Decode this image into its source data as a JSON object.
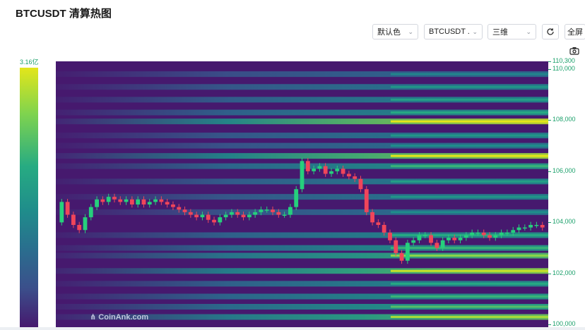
{
  "title": "BTCUSDT 清算热图",
  "controls": {
    "color_select": "默认色",
    "symbol_select": "BTCUSDT ...",
    "view_select": "三维",
    "refresh_icon": "refresh-icon",
    "fullscreen_label": "全屏",
    "camera_icon": "camera-icon"
  },
  "legend": {
    "max_label": "3.16亿"
  },
  "watermark": "CoinAnk.com",
  "chart_data": {
    "type": "heatmap",
    "title": "",
    "xlabel": "",
    "ylabel": "",
    "ylim": [
      99900,
      110300
    ],
    "y_ticks": [
      110300,
      110000,
      108000,
      106000,
      104000,
      102000,
      100000
    ],
    "y_tick_labels": [
      "110,300",
      "110,000",
      "108,000",
      "106,000",
      "104,000",
      "102,000",
      "100,000"
    ],
    "colorscale": {
      "max": "3.16亿",
      "colors": [
        "#46196e",
        "#3b4f8b",
        "#2a6e8e",
        "#1f8d8b",
        "#27ab82",
        "#7ed34f",
        "#e3e61a"
      ]
    },
    "liquidation_levels": [
      {
        "price": 109800,
        "intensity": 0.35
      },
      {
        "price": 109300,
        "intensity": 0.45
      },
      {
        "price": 108800,
        "intensity": 0.5
      },
      {
        "price": 108300,
        "intensity": 0.55
      },
      {
        "price": 107950,
        "intensity": 0.95
      },
      {
        "price": 107400,
        "intensity": 0.45
      },
      {
        "price": 107000,
        "intensity": 0.4
      },
      {
        "price": 106600,
        "intensity": 0.9
      },
      {
        "price": 106200,
        "intensity": 0.6
      },
      {
        "price": 105600,
        "intensity": 0.5
      },
      {
        "price": 105000,
        "intensity": 0.45
      },
      {
        "price": 104400,
        "intensity": 0.4
      },
      {
        "price": 103500,
        "intensity": 0.55
      },
      {
        "price": 103000,
        "intensity": 0.6
      },
      {
        "price": 102700,
        "intensity": 0.75
      },
      {
        "price": 102100,
        "intensity": 0.85
      },
      {
        "price": 101600,
        "intensity": 0.55
      },
      {
        "price": 101100,
        "intensity": 0.6
      },
      {
        "price": 100700,
        "intensity": 0.65
      },
      {
        "price": 100300,
        "intensity": 0.8
      }
    ],
    "price_path": [
      104000,
      104800,
      104300,
      103900,
      103700,
      104200,
      104600,
      104900,
      104800,
      105000,
      104900,
      104800,
      104900,
      104700,
      104900,
      104700,
      104800,
      104900,
      104800,
      104700,
      104600,
      104500,
      104400,
      104300,
      104200,
      104300,
      104100,
      104000,
      104200,
      104300,
      104400,
      104300,
      104200,
      104300,
      104400,
      104500,
      104500,
      104400,
      104300,
      104300,
      104600,
      105300,
      106400,
      106000,
      106100,
      106200,
      105900,
      106000,
      106100,
      105900,
      105800,
      105700,
      105300,
      104400,
      104000,
      103900,
      103600,
      103300,
      102800,
      102500,
      103200,
      103300,
      103500,
      103500,
      103200,
      103000,
      103300,
      103400,
      103300,
      103400,
      103500,
      103600,
      103600,
      103500,
      103400,
      103500,
      103600,
      103600,
      103700,
      103800,
      103800,
      103900,
      103900,
      103800
    ]
  }
}
